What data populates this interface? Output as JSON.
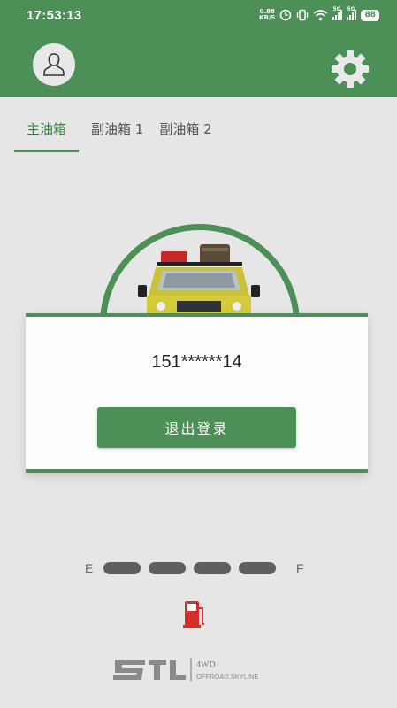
{
  "status_bar": {
    "time": "17:53:13",
    "net_speed_value": "0.88",
    "net_speed_unit": "KB/S",
    "sim1_tag": "5G",
    "sim2_tag": "5G",
    "battery": "88"
  },
  "header": {
    "avatar_icon": "user-avatar-icon",
    "settings_icon": "gear-icon"
  },
  "tabs": [
    {
      "label": "主油箱",
      "active": true
    },
    {
      "label": "副油箱 1",
      "active": false
    },
    {
      "label": "副油箱 2",
      "active": false
    }
  ],
  "account": {
    "phone": "151******14",
    "logout_label": "退出登录"
  },
  "fuel_gauge": {
    "empty_label": "E",
    "full_label": "F",
    "segments": 4
  },
  "brand": {
    "logo_text": "4WD",
    "logo_subtext": "OFFROAD.SKYLINE"
  },
  "colors": {
    "primary": "#4c8f57",
    "fuel_icon": "#d32f2f"
  }
}
